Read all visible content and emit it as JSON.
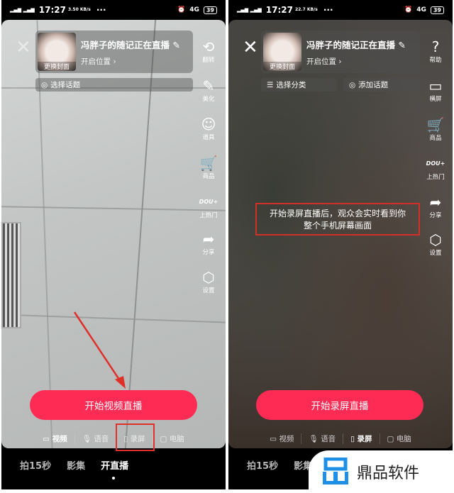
{
  "left": {
    "status": {
      "time": "17:27",
      "speed": "3.50 KB/s",
      "battery": "39",
      "network": "4G"
    },
    "card": {
      "title": "冯胖子的随记正在直播",
      "cover_label": "更换封面",
      "location": "开启位置"
    },
    "topic": "选择话题",
    "side": [
      {
        "icon": "flip-camera-icon",
        "glyph": "⟲",
        "label": "翻转"
      },
      {
        "icon": "beauty-wand-icon",
        "glyph": "✎",
        "label": "美化"
      },
      {
        "icon": "smiley-icon",
        "glyph": "☺",
        "label": "道具"
      },
      {
        "icon": "cart-icon",
        "glyph": "🛒",
        "label": "商品"
      },
      {
        "icon": "dou-plus-icon",
        "glyph": "DOU+",
        "label": "上热门"
      },
      {
        "icon": "share-icon",
        "glyph": "➦",
        "label": "分享"
      },
      {
        "icon": "settings-icon",
        "glyph": "⬡",
        "label": "设置"
      }
    ],
    "start": "开始视频直播",
    "modes": [
      "视频",
      "语音",
      "录屏",
      "电脑"
    ],
    "active_mode": "视频",
    "tabs": [
      "拍15秒",
      "影集",
      "开直播"
    ]
  },
  "right": {
    "status": {
      "time": "17:27",
      "speed": "22.7 KB/s",
      "battery": "39",
      "network": "4G"
    },
    "card": {
      "title": "冯胖子的随记正在直播",
      "cover_label": "更换封面",
      "location": "开启位置"
    },
    "category": "选择分类",
    "topic": "添加话题",
    "side": [
      {
        "icon": "help-icon",
        "glyph": "?",
        "label": "帮助"
      },
      {
        "icon": "landscape-icon",
        "glyph": "▭",
        "label": "横屏"
      },
      {
        "icon": "cart-icon",
        "glyph": "🛒",
        "label": "商品"
      },
      {
        "icon": "dou-plus-icon",
        "glyph": "DOU+",
        "label": "上热门"
      },
      {
        "icon": "share-icon",
        "glyph": "➦",
        "label": "分享"
      },
      {
        "icon": "settings-icon",
        "glyph": "⬡",
        "label": "设置"
      }
    ],
    "tip_line1": "开始录屏直播后，观众会实时看到你",
    "tip_line2": "整个手机屏幕画面",
    "start": "开始录屏直播",
    "modes": [
      "视频",
      "语音",
      "录屏",
      "电脑"
    ],
    "active_mode": "录屏",
    "tabs": [
      "拍15秒",
      "影集"
    ]
  },
  "watermark": {
    "text": "鼎品软件",
    "color": "#1e8fe6"
  },
  "accent": "#fe2c55"
}
